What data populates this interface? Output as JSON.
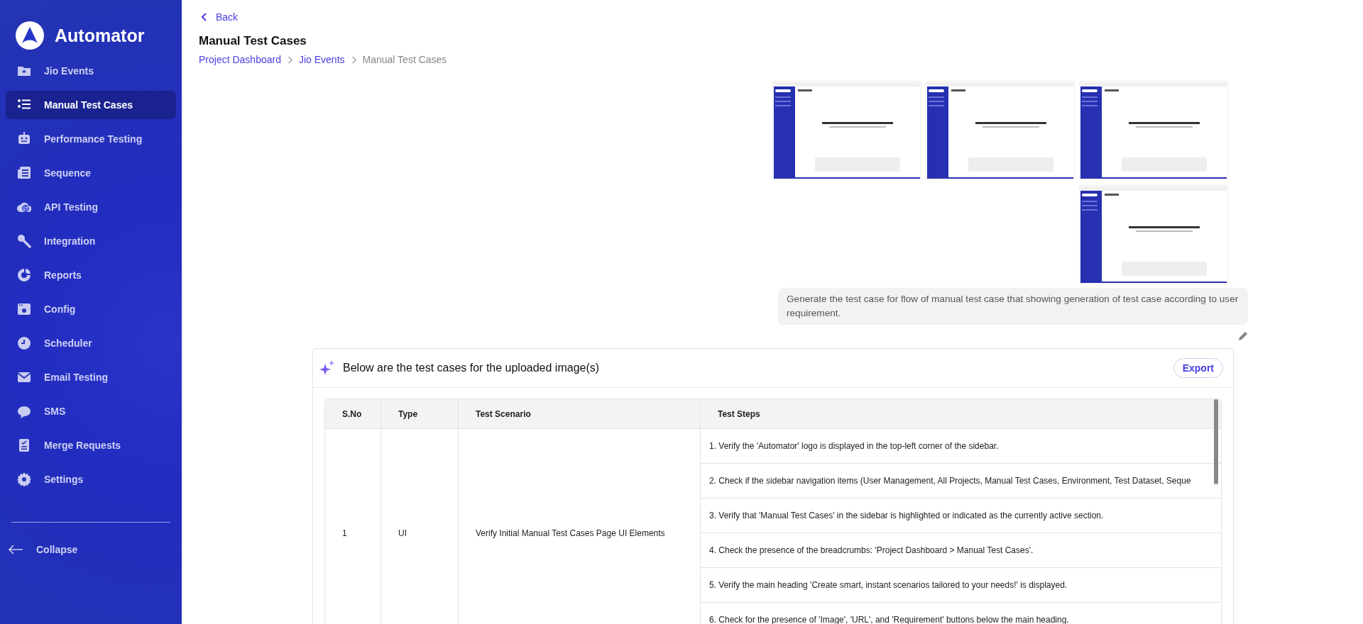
{
  "sidebar": {
    "logo": "Automator",
    "items": [
      {
        "label": "Jio Events",
        "selected": false
      },
      {
        "label": "Manual Test Cases",
        "selected": true
      },
      {
        "label": "Performance Testing",
        "selected": false
      },
      {
        "label": "Sequence",
        "selected": false
      },
      {
        "label": "API Testing",
        "selected": false
      },
      {
        "label": "Integration",
        "selected": false
      },
      {
        "label": "Reports",
        "selected": false
      },
      {
        "label": "Config",
        "selected": false
      },
      {
        "label": "Scheduler",
        "selected": false
      },
      {
        "label": "Email Testing",
        "selected": false
      },
      {
        "label": "SMS",
        "selected": false
      },
      {
        "label": "Merge Requests",
        "selected": false
      },
      {
        "label": "Settings",
        "selected": false
      }
    ],
    "collapse": "Collapse"
  },
  "header": {
    "back": "Back",
    "title": "Manual Test Cases",
    "breadcrumbs": [
      "Project Dashboard",
      "Jio Events",
      "Manual Test Cases"
    ]
  },
  "chat": {
    "message": "Generate the test case for flow of manual test case that showing generation of test case according to user requirement."
  },
  "result": {
    "title": "Below are the test cases for the uploaded image(s)",
    "export": "Export",
    "table": {
      "columns": [
        "S.No",
        "Type",
        "Test Scenario",
        "Test Steps"
      ],
      "rows": [
        {
          "sno": "1",
          "type": "UI",
          "scenario": "Verify Initial Manual Test Cases Page UI Elements",
          "steps": [
            "1. Verify the 'Automator' logo is displayed in the top-left corner of the sidebar.",
            "2. Check if the sidebar navigation items (User Management, All Projects, Manual Test Cases, Environment, Test Dataset, Seque",
            "3. Verify that 'Manual Test Cases' in the sidebar is highlighted or indicated as the currently active section.",
            "4. Check the presence of the breadcrumbs: 'Project Dashboard > Manual Test Cases'.",
            "5. Verify the main heading 'Create smart, instant scenarios tailored to your needs!' is displayed.",
            "6. Check for the presence of 'Image', 'URL', and 'Requirement' buttons below the main heading."
          ]
        }
      ]
    }
  }
}
